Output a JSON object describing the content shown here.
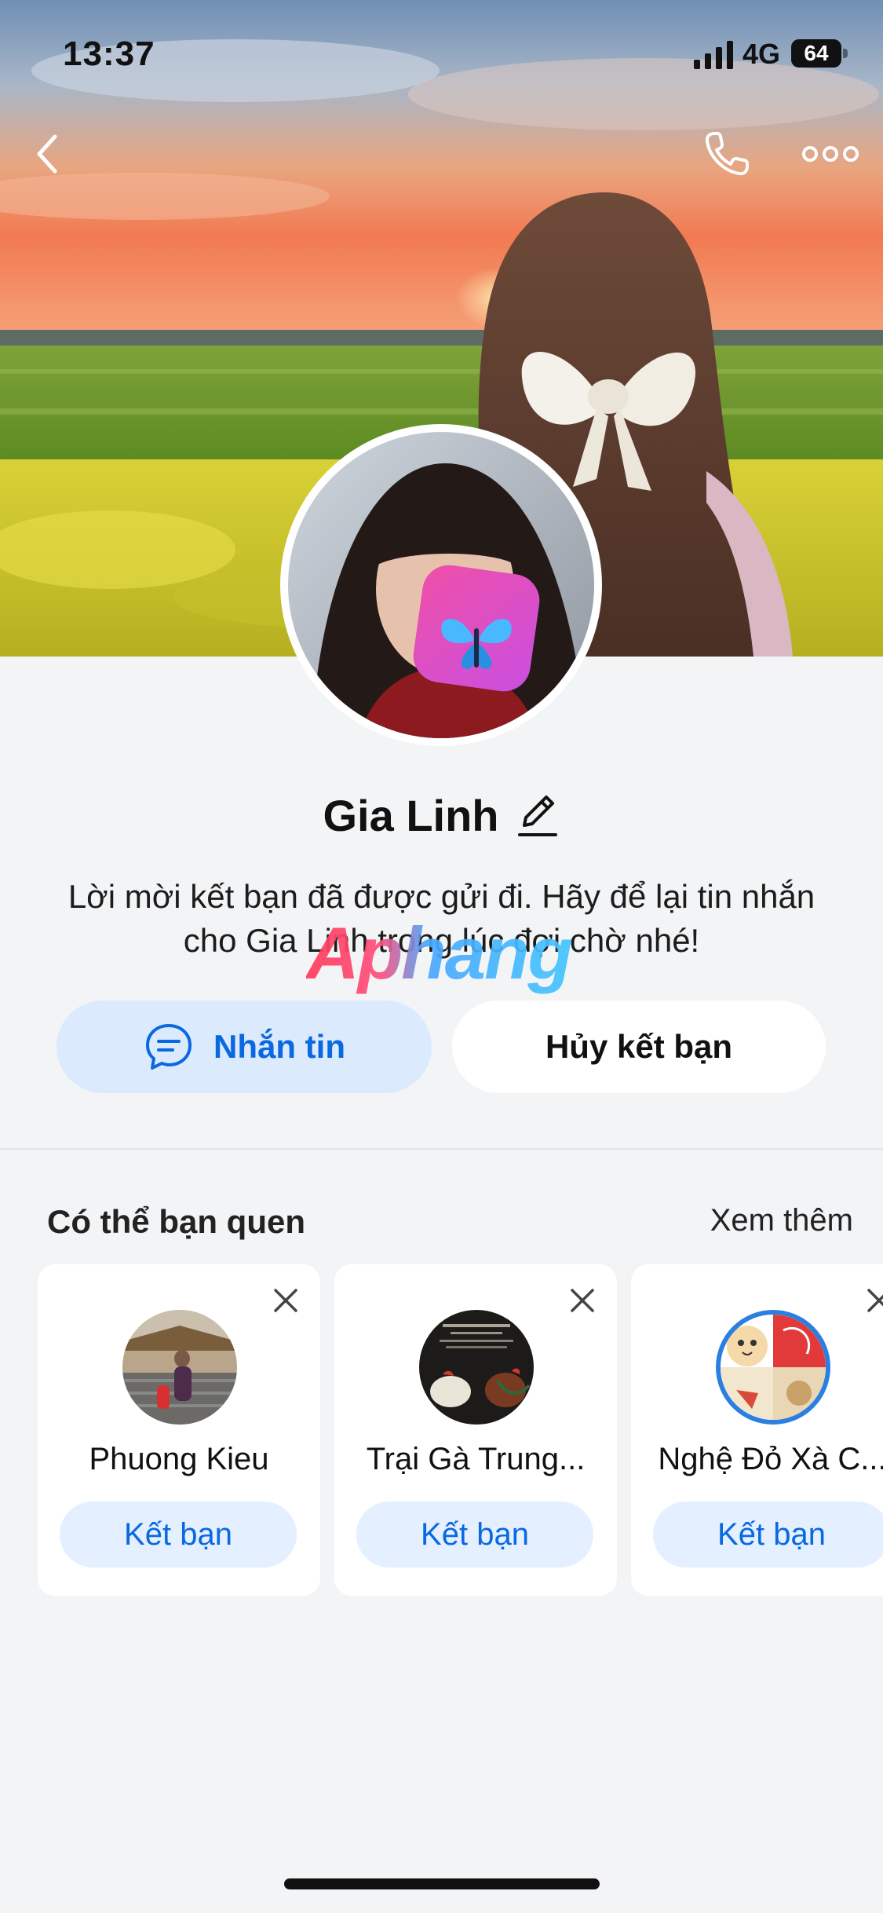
{
  "status_bar": {
    "time": "13:37",
    "network": "4G",
    "battery": "64"
  },
  "nav": {
    "back_icon": "chevron-left-icon",
    "call_icon": "phone-icon",
    "more_icon": "more-dots-icon"
  },
  "profile": {
    "name": "Gia Linh",
    "notice": "Lời mời kết bạn đã được gửi đi. Hãy để lại tin nhắn cho Gia Linh trong lúc đợi chờ nhé!"
  },
  "watermark": {
    "text": "Aphang"
  },
  "actions": {
    "message_label": "Nhắn tin",
    "unfriend_label": "Hủy kết bạn"
  },
  "suggestions": {
    "title": "Có thể bạn quen",
    "see_more": "Xem thêm",
    "items": [
      {
        "name": "Phuong Kieu",
        "button": "Kết bạn"
      },
      {
        "name": "Trại Gà Trung...",
        "button": "Kết bạn"
      },
      {
        "name": "Nghệ Đỏ Xà C...",
        "button": "Kết bạn"
      }
    ]
  },
  "colors": {
    "accent": "#0a68e0",
    "message_bg": "#dceafe",
    "page_bg": "#f3f4f6"
  }
}
